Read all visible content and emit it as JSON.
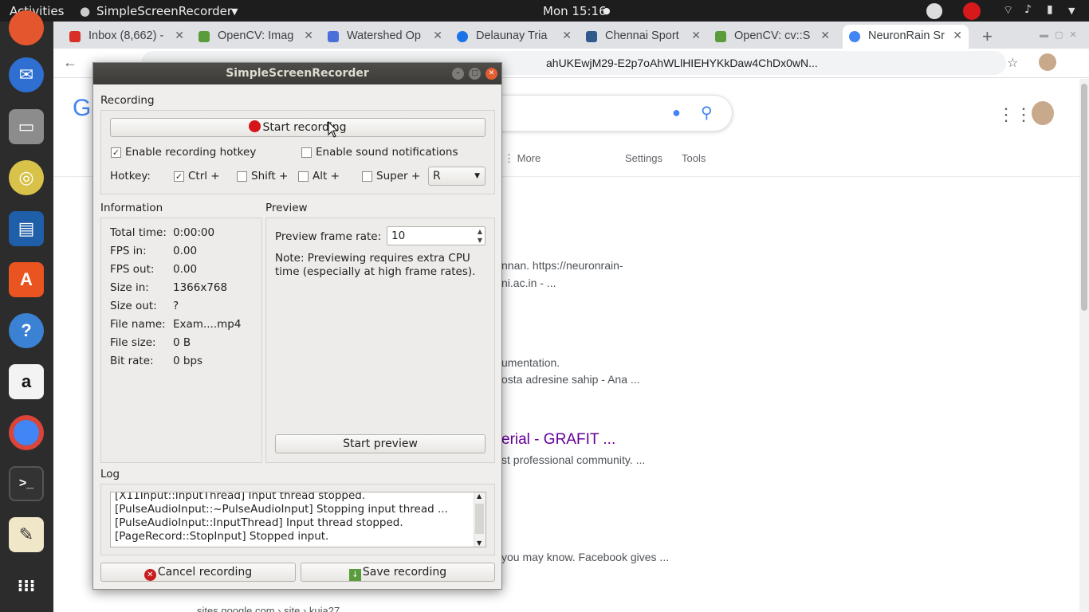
{
  "topbar": {
    "activities": "Activities",
    "app_name": "SimpleScreenRecorder",
    "clock": "Mon 15:16"
  },
  "browser": {
    "tabs": [
      {
        "title": "Inbox (8,662) -",
        "color": "#d93025"
      },
      {
        "title": "OpenCV: Imag",
        "color": "#5a9c3c"
      },
      {
        "title": "Watershed Op",
        "color": "#4a6fd8"
      },
      {
        "title": "Delaunay Tria",
        "color": "#1a73e8"
      },
      {
        "title": "Chennai Sport",
        "color": "#2f5b8c"
      },
      {
        "title": "OpenCV: cv::S",
        "color": "#5a9c3c"
      },
      {
        "title": "NeuronRain Sr",
        "color": "#4285f4"
      }
    ],
    "new_tab": "+",
    "url": "ahUKEwjM29-E2p7oAhWLlHIEHYKkDaw4ChDx0wN...",
    "nav": {
      "more": "⋮ More",
      "settings": "Settings",
      "tools": "Tools"
    },
    "results": [
      "nnan. https://neuronrain-",
      "ni.ac.in - ...",
      "umentation.",
      "osta adresine sahip - Ana ...",
      "erial - GRAFIT ...",
      "st professional community. ...",
      "you may know. Facebook gives ...",
      "sites.google.com › site › kuja27"
    ]
  },
  "dialog": {
    "title": "SimpleScreenRecorder",
    "recording": {
      "header": "Recording",
      "start_button": "Start recording",
      "enable_hotkey": "Enable recording hotkey",
      "enable_hotkey_checked": true,
      "enable_sound": "Enable sound notifications",
      "enable_sound_checked": false,
      "hotkey_label": "Hotkey:",
      "ctrl": "Ctrl +",
      "ctrl_checked": true,
      "shift": "Shift +",
      "shift_checked": false,
      "alt": "Alt +",
      "alt_checked": false,
      "super": "Super +",
      "super_checked": false,
      "key": "R"
    },
    "information": {
      "header": "Information",
      "rows": [
        {
          "label": "Total time:",
          "value": "0:00:00"
        },
        {
          "label": "FPS in:",
          "value": "0.00"
        },
        {
          "label": "FPS out:",
          "value": "0.00"
        },
        {
          "label": "Size in:",
          "value": "1366x768"
        },
        {
          "label": "Size out:",
          "value": "?"
        },
        {
          "label": "File name:",
          "value": "Exam....mp4"
        },
        {
          "label": "File size:",
          "value": "0 B"
        },
        {
          "label": "Bit rate:",
          "value": "0 bps"
        }
      ]
    },
    "preview": {
      "header": "Preview",
      "frame_rate_label": "Preview frame rate:",
      "frame_rate": "10",
      "note_line1": "Note: Previewing requires extra CPU",
      "note_line2": "time (especially at high frame rates).",
      "start_preview": "Start preview"
    },
    "log": {
      "header": "Log",
      "lines": [
        "[X11Input::InputThread] Input thread stopped.",
        "[PulseAudioInput::~PulseAudioInput] Stopping input thread ...",
        "[PulseAudioInput::InputThread] Input thread stopped.",
        "[PageRecord::StopInput] Stopped input."
      ]
    },
    "cancel_button": "Cancel recording",
    "save_button": "Save recording"
  }
}
